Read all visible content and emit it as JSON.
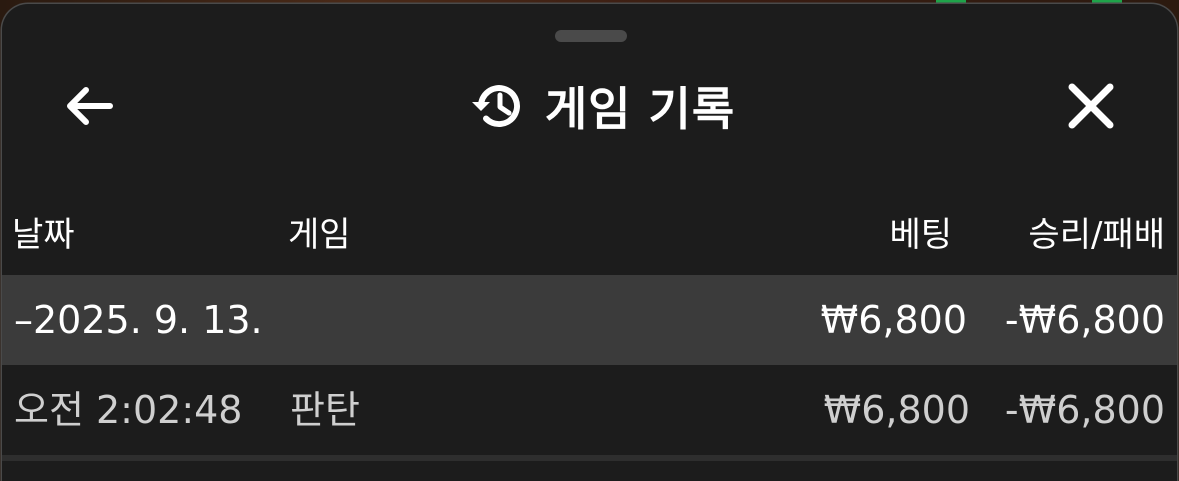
{
  "header": {
    "title": "게임 기록",
    "back_icon": "arrow-left-icon",
    "history_icon": "history-icon",
    "close_icon": "close-icon"
  },
  "columns": {
    "date": "날짜",
    "game": "게임",
    "bet": "베팅",
    "win_loss": "승리/패배"
  },
  "date_group": {
    "label": "–2025. 9. 13.",
    "bet_total": "₩6,800",
    "win_loss_total": "-₩6,800"
  },
  "rows": [
    {
      "time": "오전 2:02:48",
      "game": "판탄",
      "bet": "₩6,800",
      "win_loss": "-₩6,800"
    }
  ],
  "colors": {
    "sheet_background": "#1c1c1c",
    "date_row_background": "#3b3b3b",
    "text_primary": "#ffffff",
    "text_secondary": "#cfcfcf"
  }
}
